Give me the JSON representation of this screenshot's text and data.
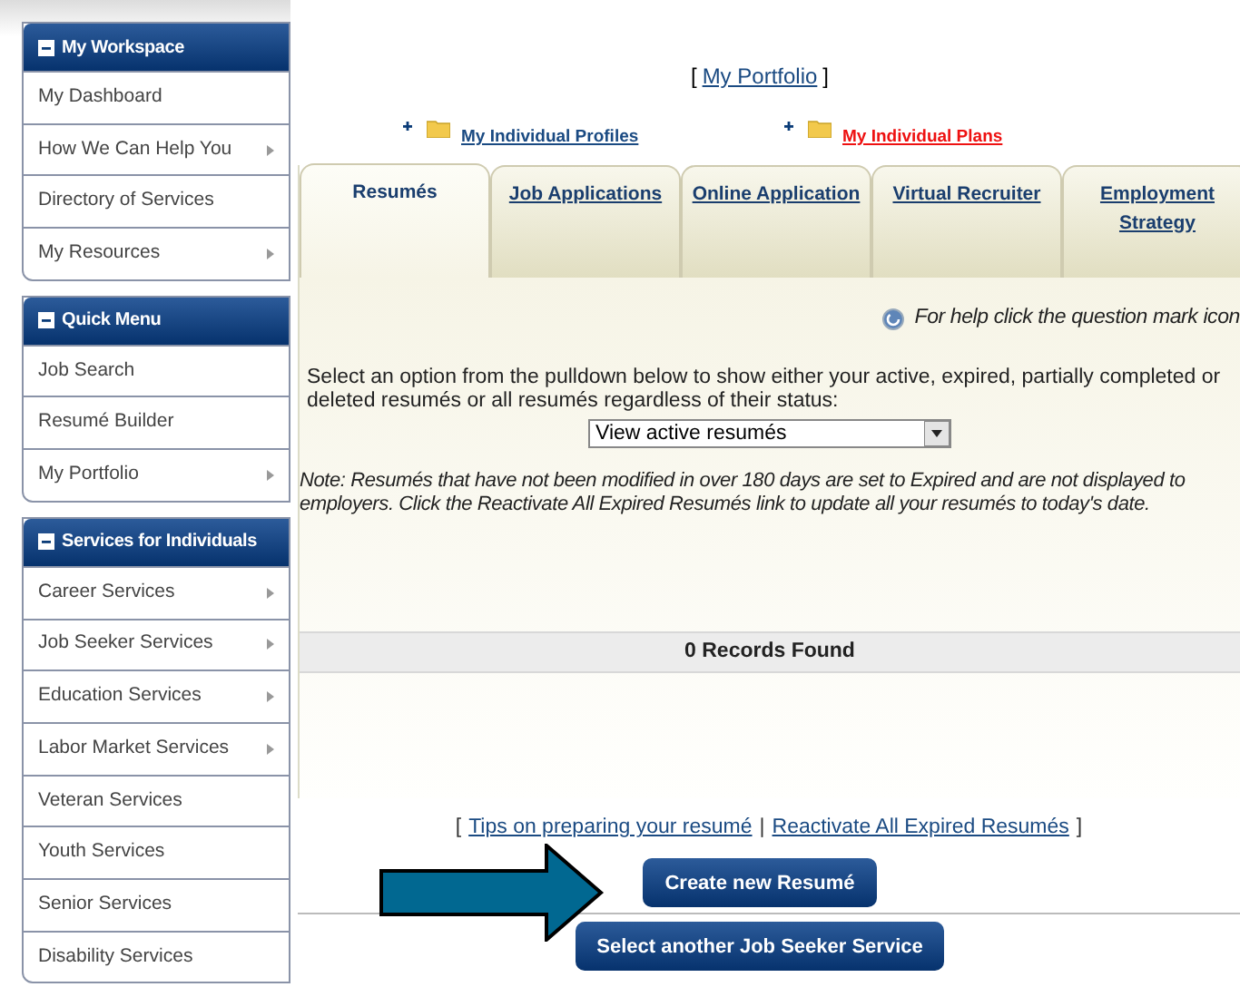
{
  "sidebar": {
    "panels": [
      {
        "title": "My Workspace",
        "expanded": true,
        "items": [
          {
            "label": "My Dashboard",
            "has_submenu": false
          },
          {
            "label": "How We Can Help You",
            "has_submenu": true
          },
          {
            "label": "Directory of Services",
            "has_submenu": false
          },
          {
            "label": "My Resources",
            "has_submenu": true
          }
        ]
      },
      {
        "title": "Quick Menu",
        "expanded": true,
        "items": [
          {
            "label": "Job Search",
            "has_submenu": false
          },
          {
            "label": "Resumé Builder",
            "has_submenu": false
          },
          {
            "label": "My Portfolio",
            "has_submenu": true
          }
        ]
      },
      {
        "title": "Services for Individuals",
        "expanded": true,
        "items": [
          {
            "label": "Career Services",
            "has_submenu": true
          },
          {
            "label": "Job Seeker Services",
            "has_submenu": true
          },
          {
            "label": "Education Services",
            "has_submenu": true
          },
          {
            "label": "Labor Market Services",
            "has_submenu": true
          },
          {
            "label": "Veteran Services",
            "has_submenu": false
          },
          {
            "label": "Youth Services",
            "has_submenu": false
          },
          {
            "label": "Senior Services",
            "has_submenu": false
          },
          {
            "label": "Disability Services",
            "has_submenu": false
          }
        ]
      }
    ]
  },
  "portfolio_link": {
    "open": "[",
    "label": "My Portfolio",
    "close": "]"
  },
  "folders": [
    {
      "label": "My Individual Profiles",
      "highlighted": false
    },
    {
      "label": "My Individual Plans",
      "highlighted": true
    }
  ],
  "tabs": [
    {
      "label": "Resumés",
      "selected": true
    },
    {
      "label": "Job Applications",
      "selected": false
    },
    {
      "label": "Online Application",
      "selected": false
    },
    {
      "label": "Virtual Recruiter",
      "selected": false
    },
    {
      "label": "Employment Strategy",
      "selected": false
    }
  ],
  "help_text": "For help click the question mark icon",
  "instructions": "Select an option from the pulldown below to show either your active, expired, partially completed or deleted resumés or all resumés regardless of their status:",
  "filter_select": {
    "value": "View active resumés"
  },
  "note": "Note: Resumés that have not been modified in over 180 days are set to Expired and are not displayed to employers. Click the Reactivate All Expired Resumés link to update all your resumés to today's date.",
  "records_header": "0 Records Found",
  "bottom_links": {
    "open": "[",
    "links": [
      "Tips on preparing your resumé",
      "Reactivate All Expired Resumés"
    ],
    "separator": "|",
    "close": "]"
  },
  "create_button": "Create new Resumé",
  "select_service_button": "Select another Job Seeker Service"
}
